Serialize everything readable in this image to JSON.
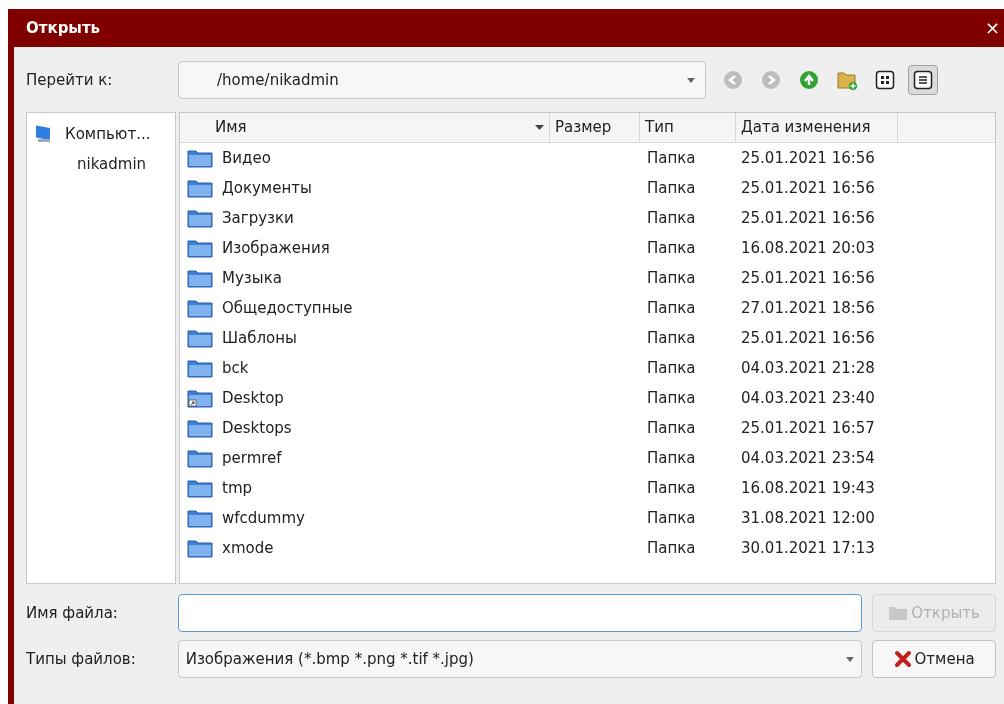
{
  "window": {
    "title": "Открыть",
    "close": "×"
  },
  "location": {
    "label": "Перейти к:",
    "value": "/home/nikadmin"
  },
  "toolbar": [
    {
      "kind": "back",
      "disabled": true
    },
    {
      "kind": "forward",
      "disabled": true
    },
    {
      "kind": "up",
      "disabled": false
    },
    {
      "kind": "new-folder",
      "disabled": false
    },
    {
      "kind": "icon-view",
      "selected": false
    },
    {
      "kind": "detail-view",
      "selected": true
    }
  ],
  "sidebar": {
    "items": [
      {
        "label": "Компьют...",
        "kind": "computer"
      },
      {
        "label": "nikadmin",
        "kind": "plain"
      }
    ]
  },
  "table": {
    "columns": [
      {
        "label": "Имя",
        "sorted": true
      },
      {
        "label": "Размер",
        "sorted": false
      },
      {
        "label": "Тип",
        "sorted": false
      },
      {
        "label": "Дата изменения",
        "sorted": false
      }
    ],
    "rows": [
      {
        "name": "Видео",
        "kind": "folder",
        "type": "Папка",
        "date": "25.01.2021 16:56"
      },
      {
        "name": "Документы",
        "kind": "folder",
        "type": "Папка",
        "date": "25.01.2021 16:56"
      },
      {
        "name": "Загрузки",
        "kind": "folder",
        "type": "Папка",
        "date": "25.01.2021 16:56"
      },
      {
        "name": "Изображения",
        "kind": "folder",
        "type": "Папка",
        "date": "16.08.2021 20:03"
      },
      {
        "name": "Музыка",
        "kind": "folder",
        "type": "Папка",
        "date": "25.01.2021 16:56"
      },
      {
        "name": "Общедоступные",
        "kind": "folder",
        "type": "Папка",
        "date": "27.01.2021 18:56"
      },
      {
        "name": "Шаблоны",
        "kind": "folder",
        "type": "Папка",
        "date": "25.01.2021 16:56"
      },
      {
        "name": "bck",
        "kind": "folder",
        "type": "Папка",
        "date": "04.03.2021 21:28"
      },
      {
        "name": "Desktop",
        "kind": "link",
        "type": "Папка",
        "date": "04.03.2021 23:40"
      },
      {
        "name": "Desktops",
        "kind": "folder",
        "type": "Папка",
        "date": "25.01.2021 16:57"
      },
      {
        "name": "permref",
        "kind": "folder",
        "type": "Папка",
        "date": "04.03.2021 23:54"
      },
      {
        "name": "tmp",
        "kind": "folder",
        "type": "Папка",
        "date": "16.08.2021 19:43"
      },
      {
        "name": "wfcdummy",
        "kind": "folder",
        "type": "Папка",
        "date": "31.08.2021 12:00"
      },
      {
        "name": "xmode",
        "kind": "folder",
        "type": "Папка",
        "date": "30.01.2021 17:13"
      }
    ]
  },
  "filename": {
    "label": "Имя файла:"
  },
  "filetypes": {
    "label": "Типы файлов:",
    "value": "Изображения (*.bmp *.png *.tif *.jpg)"
  },
  "buttons": [
    {
      "label": "Открыть",
      "kind": "open",
      "disabled": true
    },
    {
      "label": "Отмена",
      "kind": "cancel",
      "disabled": false
    }
  ]
}
